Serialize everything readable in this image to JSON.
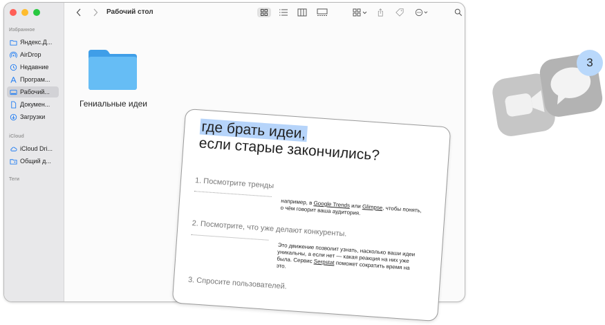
{
  "toolbar": {
    "title": "Рабочий стол"
  },
  "sidebar": {
    "favorites_label": "Избранное",
    "favorites": [
      {
        "label": "Яндекс.Д...",
        "icon": "folder-icon"
      },
      {
        "label": "AirDrop",
        "icon": "airdrop-icon"
      },
      {
        "label": "Недавние",
        "icon": "clock-icon"
      },
      {
        "label": "Програм...",
        "icon": "applications-icon"
      },
      {
        "label": "Рабочий...",
        "icon": "desktop-icon",
        "selected": true
      },
      {
        "label": "Докумен...",
        "icon": "document-icon"
      },
      {
        "label": "Загрузки",
        "icon": "download-icon"
      }
    ],
    "icloud_label": "iCloud",
    "icloud": [
      {
        "label": "iCloud Dri...",
        "icon": "cloud-icon"
      },
      {
        "label": "Общий д...",
        "icon": "shared-folder-icon"
      }
    ],
    "tags_label": "Теги"
  },
  "main": {
    "folder_label": "Гениальные идеи"
  },
  "card": {
    "title_highlight": "где брать идеи,",
    "title_rest": "если старые закончились?",
    "item1": {
      "heading": "1. Посмотрите тренды",
      "pre": "например, в ",
      "link1": "Google Trends",
      "mid": " или ",
      "link2": "Glimpse",
      "post": ", чтобы понять, о чём говорит ваша аудитория."
    },
    "item2": {
      "heading": "2. Посмотрите, что уже делают конкуренты.",
      "pre": "Это движение позволит узнать, насколько ваши идеи уникальны, а если нет — какая реакция на них уже была. Сервис ",
      "link": "Serpstat",
      "post": " поможет сократить время на это."
    },
    "item3": {
      "heading": "3. Спросите пользователей."
    }
  },
  "messages_badge": {
    "count": "3"
  },
  "colors": {
    "traffic_red": "#ff5f57",
    "traffic_yellow": "#febc2e",
    "traffic_green": "#28c840",
    "folder_blue": "#5fb7f3",
    "highlight": "#b6d4fa",
    "badge": "#b9d8fb"
  }
}
